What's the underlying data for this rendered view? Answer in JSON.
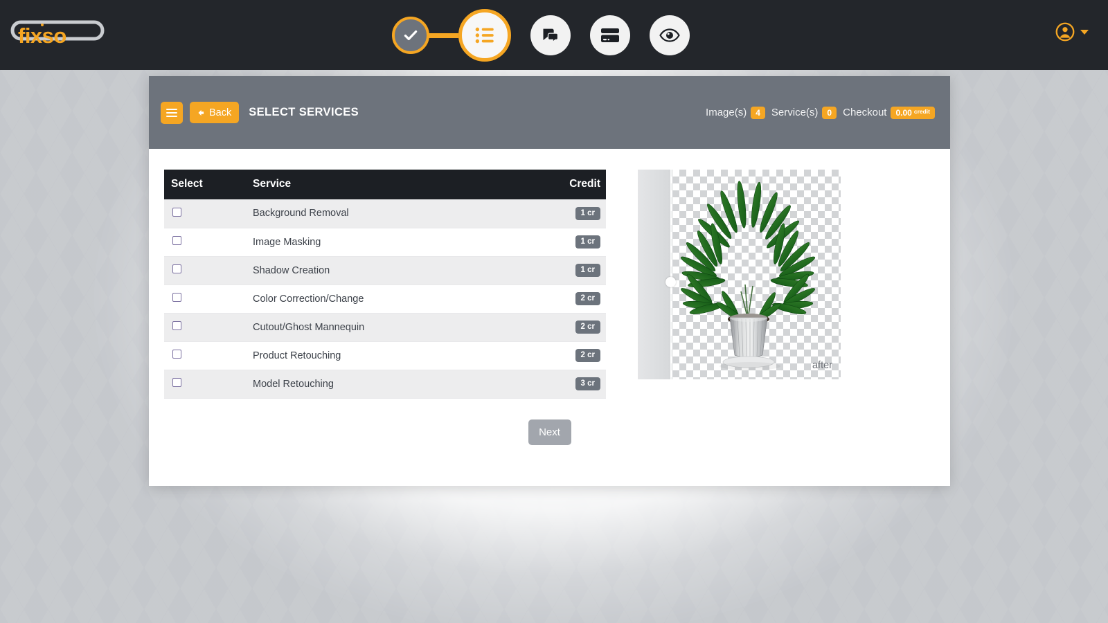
{
  "navbar": {
    "logo_text": "fixso",
    "user_icon": "user-circle-icon",
    "caret_icon": "chevron-down-icon",
    "accent_color": "#f5a623",
    "background_color": "#23262b",
    "steps": [
      {
        "id": "step-upload",
        "icon": "check-icon",
        "state": "done"
      },
      {
        "id": "step-services",
        "icon": "list-icon",
        "state": "active"
      },
      {
        "id": "step-messages",
        "icon": "chat-bubble-icon",
        "state": "pending"
      },
      {
        "id": "step-payment",
        "icon": "credit-card-icon",
        "state": "pending"
      },
      {
        "id": "step-review",
        "icon": "eye-icon",
        "state": "pending"
      }
    ]
  },
  "card_header": {
    "menu_icon": "hamburger-menu-icon",
    "back_label": "Back",
    "back_icon": "arrow-left-icon",
    "title": "SELECT SERVICES",
    "stats": [
      {
        "label": "Image(s)",
        "value": "4"
      },
      {
        "label": "Service(s)",
        "value": "0"
      }
    ],
    "checkout_label": "Checkout",
    "checkout_value": "0.00",
    "checkout_unit": "credit",
    "background_color": "#6d737c"
  },
  "services_table": {
    "columns": [
      "Select",
      "Service",
      "Credit"
    ],
    "header_background": "#1c1f24",
    "rows": [
      {
        "service": "Background Removal",
        "credit": "1 cr",
        "checked": false
      },
      {
        "service": "Image Masking",
        "credit": "1 cr",
        "checked": false
      },
      {
        "service": "Shadow Creation",
        "credit": "1 cr",
        "checked": false
      },
      {
        "service": "Color Correction/Change",
        "credit": "2 cr",
        "checked": false
      },
      {
        "service": "Cutout/Ghost Mannequin",
        "credit": "2 cr",
        "checked": false
      },
      {
        "service": "Product Retouching",
        "credit": "2 cr",
        "checked": false
      },
      {
        "service": "Model Retouching",
        "credit": "3 cr",
        "checked": false
      }
    ]
  },
  "preview": {
    "label": "after",
    "handle_icon": "slider-handle-icon",
    "image_alt": "potted-palm-plant"
  },
  "footer": {
    "next_label": "Next",
    "next_color": "#a2a6ad"
  }
}
